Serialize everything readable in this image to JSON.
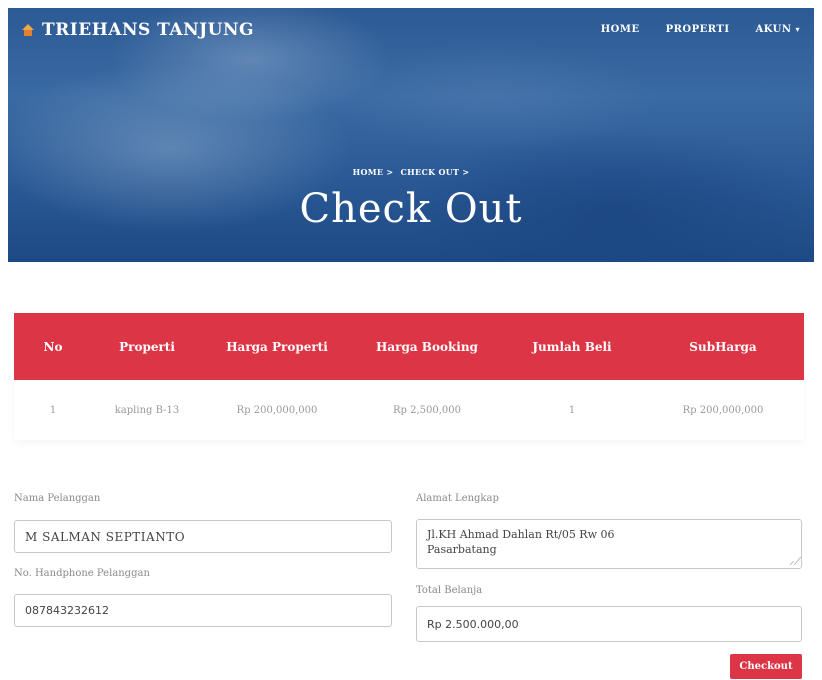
{
  "brand": {
    "name": "TRIEHANS TANJUNG",
    "icon": "home-icon"
  },
  "nav": {
    "home": "HOME",
    "properti": "PROPERTI",
    "akun": "AKUN",
    "akun_caret": "▾"
  },
  "hero": {
    "breadcrumb_home": "HOME >",
    "breadcrumb_checkout": "CHECK OUT >",
    "title": "Check Out"
  },
  "table": {
    "headers": [
      "No",
      "Properti",
      "Harga Properti",
      "Harga Booking",
      "Jumlah Beli",
      "SubHarga"
    ],
    "rows": [
      [
        "1",
        "kapling B-13",
        "Rp 200,000,000",
        "Rp 2,500,000",
        "1",
        "Rp 200,000,000"
      ]
    ]
  },
  "form": {
    "nama_label": "Nama Pelanggan",
    "nama_value": "M SALMAN SEPTIANTO",
    "hp_label": "No. Handphone Pelanggan",
    "hp_value": "087843232612",
    "alamat_label": "Alamat Lengkap",
    "alamat_line1": "Jl.KH Ahmad Dahlan Rt/05 Rw 06",
    "alamat_line2": "Pasarbatang",
    "total_label": "Total Belanja",
    "total_value": "Rp 2.500.000,00",
    "checkout_label": "Checkout"
  },
  "colors": {
    "accent": "#dc3545",
    "hero": "#2c5a94"
  }
}
